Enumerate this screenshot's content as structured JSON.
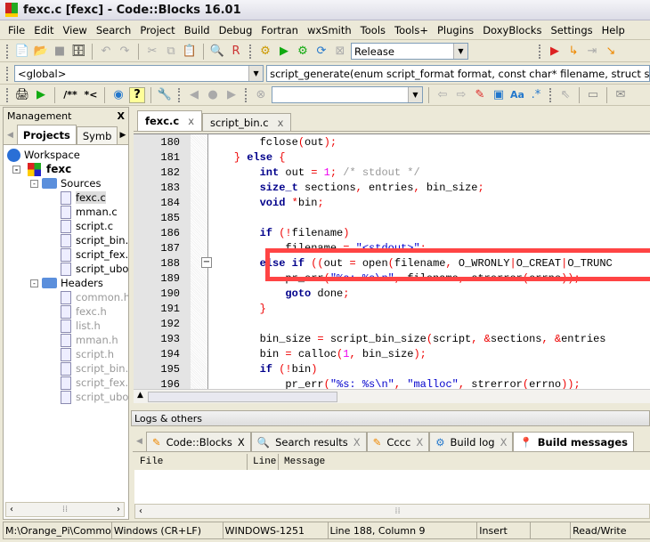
{
  "window": {
    "title": "fexc.c [fexc] - Code::Blocks 16.01"
  },
  "menu": [
    "File",
    "Edit",
    "View",
    "Search",
    "Project",
    "Build",
    "Debug",
    "Fortran",
    "wxSmith",
    "Tools",
    "Tools+",
    "Plugins",
    "DoxyBlocks",
    "Settings",
    "Help"
  ],
  "toolbar": {
    "build_target": "Release",
    "doxy_comment": "/**",
    "doxy_line": "*<"
  },
  "code_toolbar": {
    "scope": "<global>",
    "function": "script_generate(enum script_format format, const char* filename, struct script* script) :"
  },
  "management": {
    "title": "Management",
    "close": "X",
    "tabs": [
      "Projects",
      "Symb"
    ],
    "workspace": "Workspace",
    "project": "fexc",
    "sources_label": "Sources",
    "sources": [
      "fexc.c",
      "mman.c",
      "script.c",
      "script_bin.c",
      "script_fex.c",
      "script_uboot.c"
    ],
    "headers_label": "Headers",
    "headers": [
      "common.h",
      "fexc.h",
      "list.h",
      "mman.h",
      "script.h",
      "script_bin.h",
      "script_fex.h",
      "script_uboot.h"
    ]
  },
  "editor": {
    "tabs": [
      "fexc.c",
      "script_bin.c"
    ],
    "tab_close": "x",
    "lines": [
      {
        "n": "180",
        "t": [
          [
            "",
            "        fclose"
          ],
          [
            "op",
            "("
          ],
          [
            "",
            "out"
          ],
          [
            "op",
            ");"
          ]
        ]
      },
      {
        "n": "181",
        "t": [
          [
            "",
            "    "
          ],
          [
            "op",
            "}"
          ],
          [
            "",
            " "
          ],
          [
            "kw",
            "else"
          ],
          [
            "",
            " "
          ],
          [
            "op",
            "{"
          ]
        ]
      },
      {
        "n": "182",
        "t": [
          [
            "",
            "        "
          ],
          [
            "kw",
            "int"
          ],
          [
            "",
            " out "
          ],
          [
            "op",
            "="
          ],
          [
            "",
            " "
          ],
          [
            "num",
            "1"
          ],
          [
            "op",
            ";"
          ],
          [
            "",
            " "
          ],
          [
            "cm",
            "/* stdout */"
          ]
        ]
      },
      {
        "n": "183",
        "t": [
          [
            "",
            "        "
          ],
          [
            "kw",
            "size_t"
          ],
          [
            "",
            " sections"
          ],
          [
            "op",
            ","
          ],
          [
            "",
            " entries"
          ],
          [
            "op",
            ","
          ],
          [
            "",
            " bin_size"
          ],
          [
            "op",
            ";"
          ]
        ]
      },
      {
        "n": "184",
        "t": [
          [
            "",
            "        "
          ],
          [
            "kw",
            "void"
          ],
          [
            "",
            " "
          ],
          [
            "op",
            "*"
          ],
          [
            "",
            "bin"
          ],
          [
            "op",
            ";"
          ]
        ]
      },
      {
        "n": "185",
        "t": []
      },
      {
        "n": "186",
        "t": [
          [
            "",
            "        "
          ],
          [
            "kw",
            "if"
          ],
          [
            "",
            " "
          ],
          [
            "op",
            "(!"
          ],
          [
            "",
            "filename"
          ],
          [
            "op",
            ")"
          ]
        ]
      },
      {
        "n": "187",
        "t": [
          [
            "",
            "            filename "
          ],
          [
            "op",
            "="
          ],
          [
            "",
            " "
          ],
          [
            "str",
            "\"<stdout>\""
          ],
          [
            "op",
            ";"
          ]
        ]
      },
      {
        "n": "188",
        "t": [
          [
            "",
            "        "
          ],
          [
            "kw",
            "else if"
          ],
          [
            "",
            " "
          ],
          [
            "op",
            "(("
          ],
          [
            "",
            "out "
          ],
          [
            "op",
            "="
          ],
          [
            "",
            " open"
          ],
          [
            "op",
            "("
          ],
          [
            "",
            "filename"
          ],
          [
            "op",
            ","
          ],
          [
            "",
            " O_WRONLY"
          ],
          [
            "op",
            "|"
          ],
          [
            "",
            "O_CREAT"
          ],
          [
            "op",
            "|"
          ],
          [
            "",
            "O_TRUNC"
          ]
        ]
      },
      {
        "n": "189",
        "t": [
          [
            "",
            "            pr_err"
          ],
          [
            "op",
            "("
          ],
          [
            "str",
            "\"%s: %s\\n\""
          ],
          [
            "op",
            ","
          ],
          [
            "",
            " filename"
          ],
          [
            "op",
            ","
          ],
          [
            "",
            " strerror"
          ],
          [
            "op",
            "("
          ],
          [
            "",
            "errno"
          ],
          [
            "op",
            "));"
          ]
        ]
      },
      {
        "n": "190",
        "t": [
          [
            "",
            "            "
          ],
          [
            "kw",
            "goto"
          ],
          [
            "",
            " done"
          ],
          [
            "op",
            ";"
          ]
        ]
      },
      {
        "n": "191",
        "t": [
          [
            "",
            "        "
          ],
          [
            "op",
            "}"
          ]
        ]
      },
      {
        "n": "192",
        "t": []
      },
      {
        "n": "193",
        "t": [
          [
            "",
            "        bin_size "
          ],
          [
            "op",
            "="
          ],
          [
            "",
            " script_bin_size"
          ],
          [
            "op",
            "("
          ],
          [
            "",
            "script"
          ],
          [
            "op",
            ","
          ],
          [
            "",
            " "
          ],
          [
            "op",
            "&"
          ],
          [
            "",
            "sections"
          ],
          [
            "op",
            ","
          ],
          [
            "",
            " "
          ],
          [
            "op",
            "&"
          ],
          [
            "",
            "entries"
          ]
        ]
      },
      {
        "n": "194",
        "t": [
          [
            "",
            "        bin "
          ],
          [
            "op",
            "="
          ],
          [
            "",
            " calloc"
          ],
          [
            "op",
            "("
          ],
          [
            "num",
            "1"
          ],
          [
            "op",
            ","
          ],
          [
            "",
            " bin_size"
          ],
          [
            "op",
            ");"
          ]
        ]
      },
      {
        "n": "195",
        "t": [
          [
            "",
            "        "
          ],
          [
            "kw",
            "if"
          ],
          [
            "",
            " "
          ],
          [
            "op",
            "(!"
          ],
          [
            "",
            "bin"
          ],
          [
            "op",
            ")"
          ]
        ]
      },
      {
        "n": "196",
        "t": [
          [
            "",
            "            pr_err"
          ],
          [
            "op",
            "("
          ],
          [
            "str",
            "\"%s: %s\\n\""
          ],
          [
            "op",
            ","
          ],
          [
            "",
            " "
          ],
          [
            "str",
            "\"malloc\""
          ],
          [
            "op",
            ","
          ],
          [
            "",
            " strerror"
          ],
          [
            "op",
            "("
          ],
          [
            "",
            "errno"
          ],
          [
            "op",
            "));"
          ]
        ]
      }
    ]
  },
  "logs": {
    "title": "Logs & others",
    "tabs": [
      {
        "label": "Code::Blocks",
        "icon": "pencil-icon"
      },
      {
        "label": "Search results",
        "icon": "magnifier-icon"
      },
      {
        "label": "Cccc",
        "icon": "pencil-icon"
      },
      {
        "label": "Build log",
        "icon": "gear-icon"
      },
      {
        "label": "Build messages",
        "icon": "pin-icon"
      }
    ],
    "close": "X",
    "columns": [
      "File",
      "Line",
      "Message"
    ]
  },
  "status": [
    "M:\\Orange_Pi\\CommonT",
    "Windows (CR+LF)",
    "WINDOWS-1251",
    "Line 188, Column 9",
    "Insert",
    "",
    "Read/Write"
  ]
}
